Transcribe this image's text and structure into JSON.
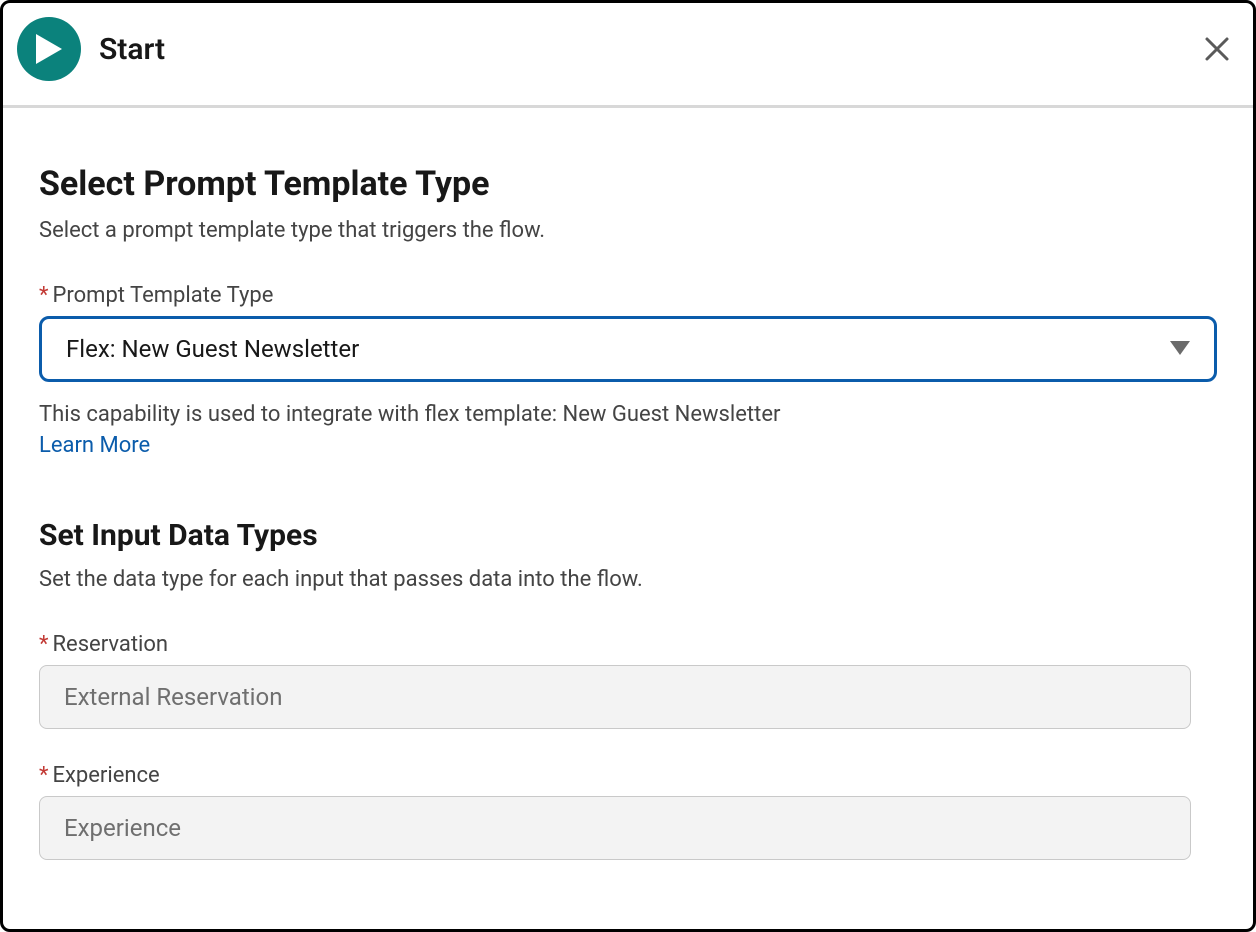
{
  "header": {
    "title": "Start"
  },
  "section1": {
    "heading": "Select Prompt Template Type",
    "description": "Select a prompt template type that triggers the flow.",
    "field_label": "Prompt Template Type",
    "selected_value": "Flex: New Guest Newsletter",
    "helper_text": "This capability is used to integrate with flex template: New Guest Newsletter",
    "learn_more_label": "Learn More"
  },
  "section2": {
    "heading": "Set Input Data Types",
    "description": "Set the data type for each input that passes data into the flow.",
    "inputs": [
      {
        "label": "Reservation",
        "value": "External Reservation"
      },
      {
        "label": "Experience",
        "value": "Experience"
      }
    ]
  }
}
